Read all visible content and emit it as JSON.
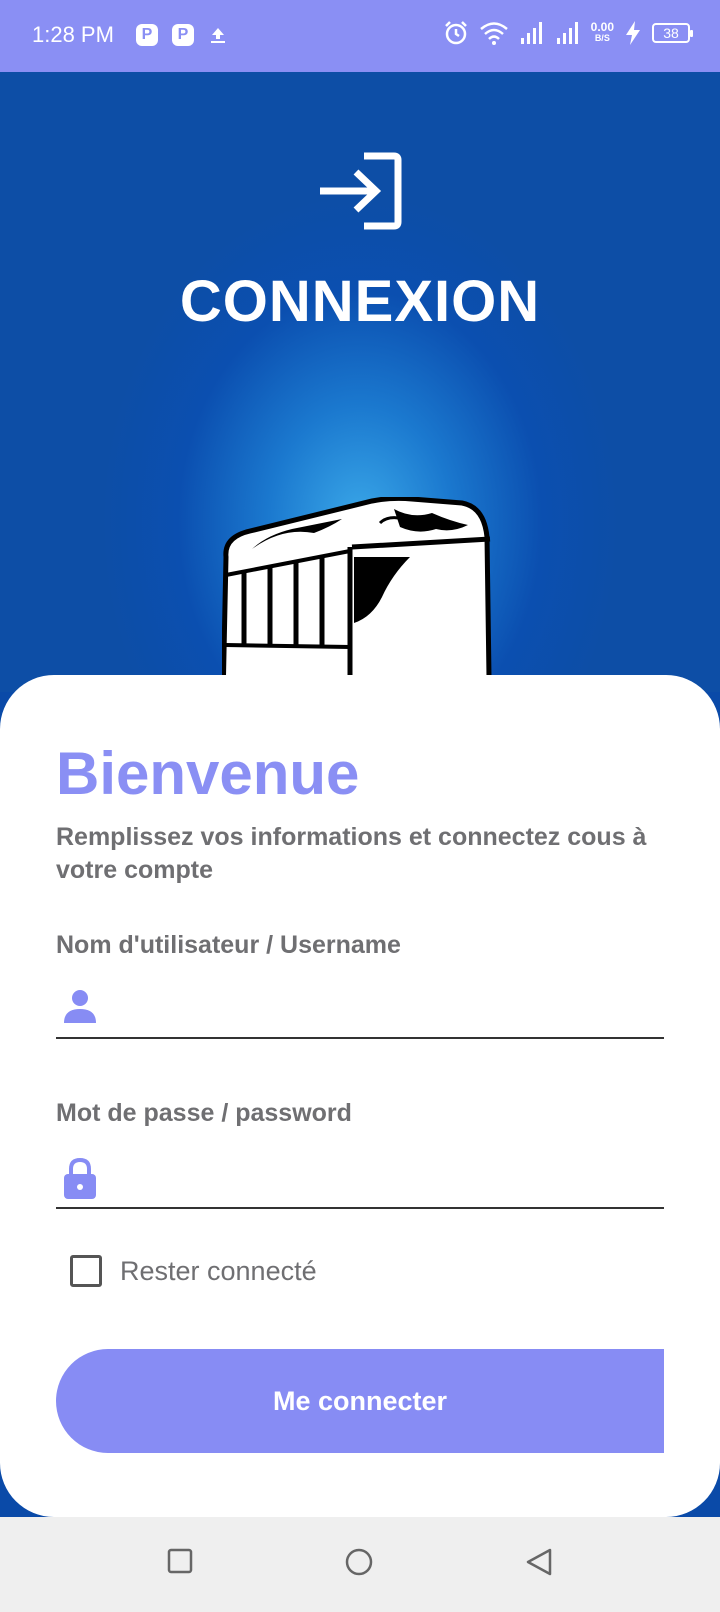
{
  "status_bar": {
    "time": "1:28 PM",
    "notification_icons": [
      "p-app-icon",
      "p-app-icon",
      "upload-icon"
    ],
    "net_speed_value": "0.00",
    "net_speed_unit": "B/S",
    "battery": "38",
    "icons": [
      "alarm-icon",
      "wifi-icon",
      "signal-icon",
      "signal-icon",
      "charging-icon"
    ]
  },
  "hero": {
    "icon": "login-icon",
    "title": "CONNEXION",
    "illustration": "bus-icon"
  },
  "card": {
    "welcome": "Bienvenue",
    "subtitle": "Remplissez vos informations et connectez cous à votre compte",
    "username": {
      "label": "Nom d'utilisateur / Username",
      "icon": "user-icon",
      "value": ""
    },
    "password": {
      "label": "Mot de passe / password",
      "icon": "lock-icon",
      "value": ""
    },
    "remember": {
      "label": "Rester connecté",
      "checked": false
    },
    "submit_label": "Me connecter"
  },
  "colors": {
    "accent": "#878cf4",
    "hero_blue": "#0b4fb0",
    "text_gray": "#6f6f72"
  },
  "nav_bar": {
    "buttons": [
      "recent-apps-icon",
      "home-icon",
      "back-icon"
    ]
  }
}
